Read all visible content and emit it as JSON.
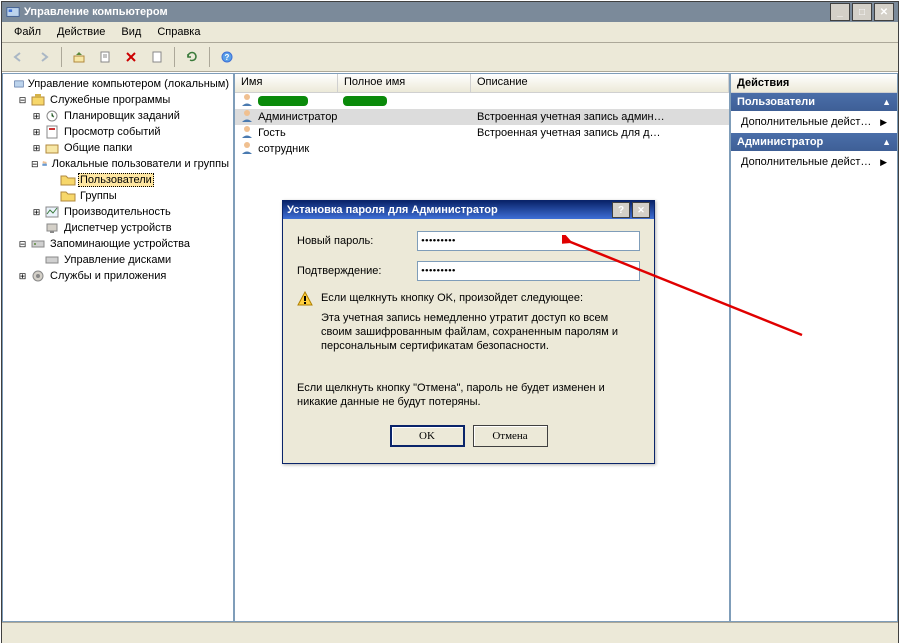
{
  "titlebar": {
    "title": "Управление компьютером"
  },
  "menu": {
    "file": "Файл",
    "action": "Действие",
    "view": "Вид",
    "help": "Справка"
  },
  "tree": {
    "root": "Управление компьютером (локальным)",
    "utilities": "Служебные программы",
    "scheduler": "Планировщик заданий",
    "eventviewer": "Просмотр событий",
    "sharedfolders": "Общие папки",
    "localusers": "Локальные пользователи и группы",
    "users": "Пользователи",
    "groups": "Группы",
    "perf": "Производительность",
    "devmgr": "Диспетчер устройств",
    "storage": "Запоминающие устройства",
    "diskmgr": "Управление дисками",
    "services": "Службы и приложения"
  },
  "list": {
    "cols": {
      "name": "Имя",
      "fullname": "Полное имя",
      "desc": "Описание"
    },
    "rows": [
      {
        "name": "",
        "full": "",
        "desc": "",
        "redacted": true
      },
      {
        "name": "Администратор",
        "full": "",
        "desc": "Встроенная учетная запись админ…"
      },
      {
        "name": "Гость",
        "full": "",
        "desc": "Встроенная учетная запись для д…"
      },
      {
        "name": "сотрудник",
        "full": "",
        "desc": ""
      }
    ]
  },
  "actions": {
    "head": "Действия",
    "sec1": "Пользователи",
    "item1": "Дополнительные дейст…",
    "sec2": "Администратор",
    "item2": "Дополнительные дейст…"
  },
  "dialog": {
    "title": "Установка пароля для Администратор",
    "newpass": "Новый пароль:",
    "confirm": "Подтверждение:",
    "pass_value": "•••••••••",
    "confirm_value": "•••••••••",
    "warn_head": "Если щелкнуть кнопку OK, произойдет следующее:",
    "warn_body": "Эта учетная запись немедленно утратит доступ ко всем своим зашифрованным файлам, сохраненным паролям и персональным сертификатам безопасности.",
    "cancel_text": "Если щелкнуть кнопку \"Отмена\", пароль не будет изменен и никакие данные не будут потеряны.",
    "ok": "OK",
    "cancel": "Отмена"
  }
}
